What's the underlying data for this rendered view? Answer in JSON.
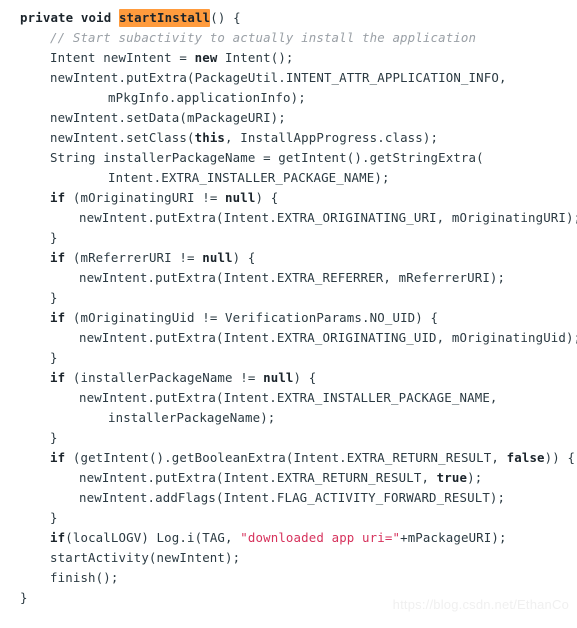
{
  "snippet": {
    "language": "java",
    "background_color": "#ffffff",
    "text_color": "#2b3a42",
    "keyword_color": "#1b242b",
    "comment_color": "#9aa0a6",
    "string_color": "#d6325c",
    "highlight_color": "#ff9b3d",
    "lines": [
      {
        "indent": 0,
        "tokens": [
          {
            "type": "kw",
            "text": "private void "
          },
          {
            "type": "hl",
            "text": "startInstall"
          },
          {
            "type": "plain",
            "text": "() {"
          }
        ]
      },
      {
        "indent": 1,
        "tokens": [
          {
            "type": "cmt",
            "text": "// Start subactivity to actually install the application"
          }
        ]
      },
      {
        "indent": 1,
        "tokens": [
          {
            "type": "plain",
            "text": "Intent newIntent = "
          },
          {
            "type": "kw",
            "text": "new"
          },
          {
            "type": "plain",
            "text": " Intent();"
          }
        ]
      },
      {
        "indent": 1,
        "tokens": [
          {
            "type": "plain",
            "text": "newIntent.putExtra(PackageUtil.INTENT_ATTR_APPLICATION_INFO,"
          }
        ]
      },
      {
        "indent": 3,
        "tokens": [
          {
            "type": "plain",
            "text": "mPkgInfo.applicationInfo);"
          }
        ]
      },
      {
        "indent": 1,
        "tokens": [
          {
            "type": "plain",
            "text": "newIntent.setData(mPackageURI);"
          }
        ]
      },
      {
        "indent": 1,
        "tokens": [
          {
            "type": "plain",
            "text": "newIntent.setClass("
          },
          {
            "type": "kw",
            "text": "this"
          },
          {
            "type": "plain",
            "text": ", InstallAppProgress.class);"
          }
        ]
      },
      {
        "indent": 1,
        "tokens": [
          {
            "type": "plain",
            "text": "String installerPackageName = getIntent().getStringExtra("
          }
        ]
      },
      {
        "indent": 3,
        "tokens": [
          {
            "type": "plain",
            "text": "Intent.EXTRA_INSTALLER_PACKAGE_NAME);"
          }
        ]
      },
      {
        "indent": 1,
        "tokens": [
          {
            "type": "kw",
            "text": "if"
          },
          {
            "type": "plain",
            "text": " (mOriginatingURI != "
          },
          {
            "type": "kw",
            "text": "null"
          },
          {
            "type": "plain",
            "text": ") {"
          }
        ]
      },
      {
        "indent": 2,
        "tokens": [
          {
            "type": "plain",
            "text": "newIntent.putExtra(Intent.EXTRA_ORIGINATING_URI, mOriginatingURI);"
          }
        ]
      },
      {
        "indent": 1,
        "tokens": [
          {
            "type": "plain",
            "text": "}"
          }
        ]
      },
      {
        "indent": 1,
        "tokens": [
          {
            "type": "kw",
            "text": "if"
          },
          {
            "type": "plain",
            "text": " (mReferrerURI != "
          },
          {
            "type": "kw",
            "text": "null"
          },
          {
            "type": "plain",
            "text": ") {"
          }
        ]
      },
      {
        "indent": 2,
        "tokens": [
          {
            "type": "plain",
            "text": "newIntent.putExtra(Intent.EXTRA_REFERRER, mReferrerURI);"
          }
        ]
      },
      {
        "indent": 1,
        "tokens": [
          {
            "type": "plain",
            "text": "}"
          }
        ]
      },
      {
        "indent": 1,
        "tokens": [
          {
            "type": "kw",
            "text": "if"
          },
          {
            "type": "plain",
            "text": " (mOriginatingUid != VerificationParams.NO_UID) {"
          }
        ]
      },
      {
        "indent": 2,
        "tokens": [
          {
            "type": "plain",
            "text": "newIntent.putExtra(Intent.EXTRA_ORIGINATING_UID, mOriginatingUid);"
          }
        ]
      },
      {
        "indent": 1,
        "tokens": [
          {
            "type": "plain",
            "text": "}"
          }
        ]
      },
      {
        "indent": 1,
        "tokens": [
          {
            "type": "kw",
            "text": "if"
          },
          {
            "type": "plain",
            "text": " (installerPackageName != "
          },
          {
            "type": "kw",
            "text": "null"
          },
          {
            "type": "plain",
            "text": ") {"
          }
        ]
      },
      {
        "indent": 2,
        "tokens": [
          {
            "type": "plain",
            "text": "newIntent.putExtra(Intent.EXTRA_INSTALLER_PACKAGE_NAME,"
          }
        ]
      },
      {
        "indent": 3,
        "tokens": [
          {
            "type": "plain",
            "text": "installerPackageName);"
          }
        ]
      },
      {
        "indent": 1,
        "tokens": [
          {
            "type": "plain",
            "text": "}"
          }
        ]
      },
      {
        "indent": 1,
        "tokens": [
          {
            "type": "kw",
            "text": "if"
          },
          {
            "type": "plain",
            "text": " (getIntent().getBooleanExtra(Intent.EXTRA_RETURN_RESULT, "
          },
          {
            "type": "kw",
            "text": "false"
          },
          {
            "type": "plain",
            "text": ")) {"
          }
        ]
      },
      {
        "indent": 2,
        "tokens": [
          {
            "type": "plain",
            "text": "newIntent.putExtra(Intent.EXTRA_RETURN_RESULT, "
          },
          {
            "type": "kw",
            "text": "true"
          },
          {
            "type": "plain",
            "text": ");"
          }
        ]
      },
      {
        "indent": 2,
        "tokens": [
          {
            "type": "plain",
            "text": "newIntent.addFlags(Intent.FLAG_ACTIVITY_FORWARD_RESULT);"
          }
        ]
      },
      {
        "indent": 1,
        "tokens": [
          {
            "type": "plain",
            "text": "}"
          }
        ]
      },
      {
        "indent": 1,
        "tokens": [
          {
            "type": "kw",
            "text": "if"
          },
          {
            "type": "plain",
            "text": "(localLOGV) Log.i(TAG, "
          },
          {
            "type": "str",
            "text": "\"downloaded app uri=\""
          },
          {
            "type": "plain",
            "text": "+mPackageURI);"
          }
        ]
      },
      {
        "indent": 1,
        "tokens": [
          {
            "type": "plain",
            "text": "startActivity(newIntent);"
          }
        ]
      },
      {
        "indent": 1,
        "tokens": [
          {
            "type": "plain",
            "text": "finish();"
          }
        ]
      },
      {
        "indent": 0,
        "tokens": [
          {
            "type": "plain",
            "text": "}"
          }
        ]
      }
    ]
  },
  "watermark": {
    "text": "https://blog.csdn.net/EthanCo"
  }
}
